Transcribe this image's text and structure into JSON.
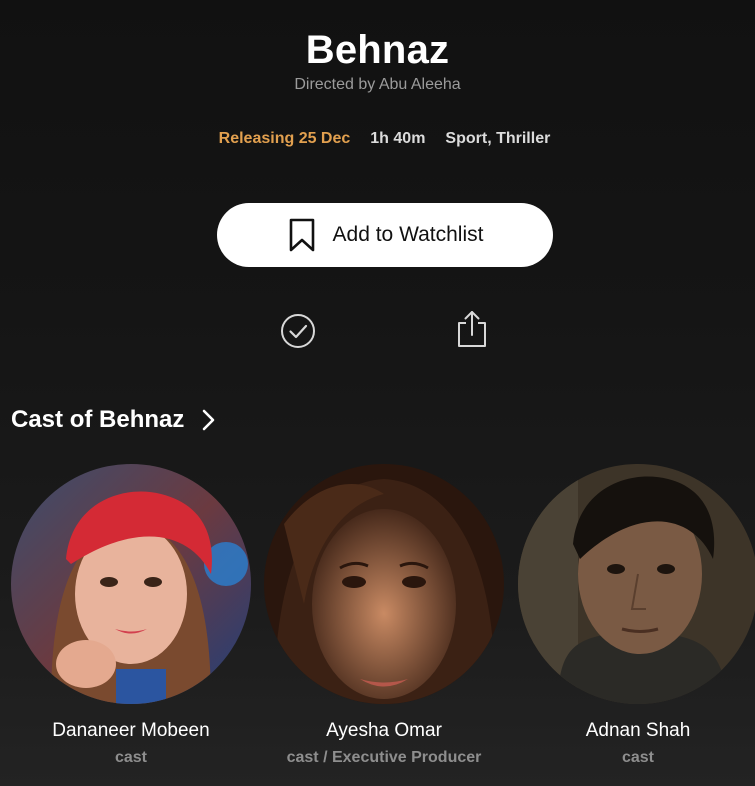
{
  "movie": {
    "title": "Behnaz",
    "director_line": "Directed by Abu Aleeha",
    "release": "Releasing 25 Dec",
    "duration": "1h 40m",
    "genres": "Sport, Thriller"
  },
  "actions": {
    "watchlist_label": "Add to Watchlist",
    "icons": [
      "bookmark-icon",
      "check-circle-icon",
      "share-icon"
    ]
  },
  "cast_section": {
    "heading": "Cast of Behnaz",
    "members": [
      {
        "name": "Dananeer Mobeen",
        "role": "cast"
      },
      {
        "name": "Ayesha Omar",
        "role": "cast / Executive Producer"
      },
      {
        "name": "Adnan Shah",
        "role": "cast"
      }
    ]
  },
  "colors": {
    "background": "#111111",
    "accent_release": "#e2a04f",
    "secondary_text": "#9b9b9b",
    "button_bg": "#ffffff"
  }
}
